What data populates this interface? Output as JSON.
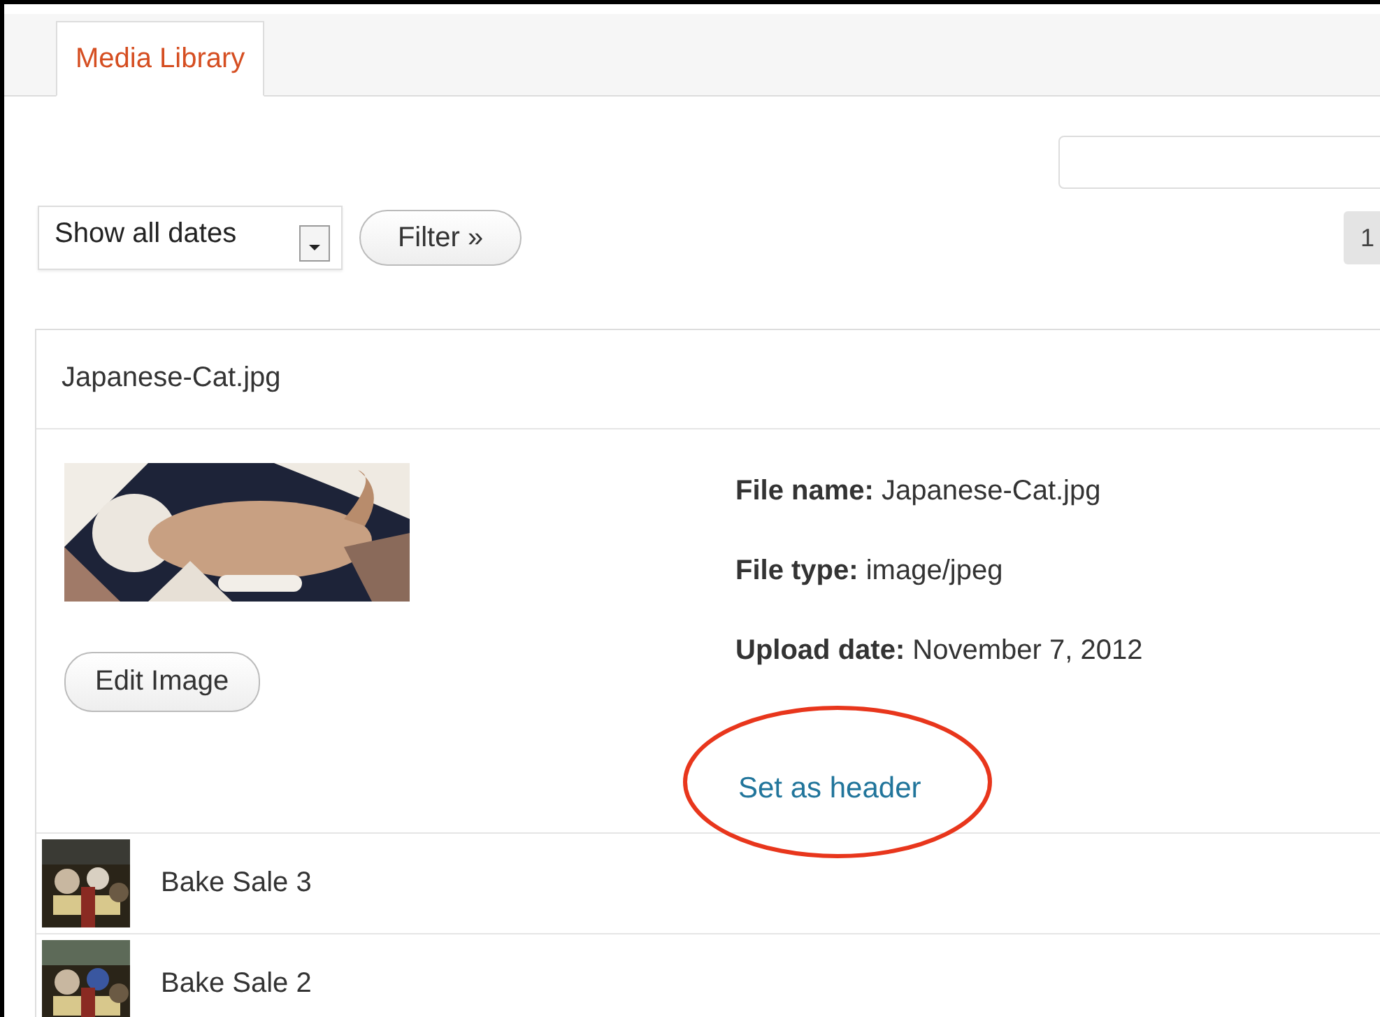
{
  "tabs": [
    {
      "label": "Media Library",
      "selected": true
    }
  ],
  "date_filter": {
    "value": "Show all dates"
  },
  "filter_button": "Filter »",
  "pagination": {
    "page": "1"
  },
  "item": {
    "title": "Japanese-Cat.jpg",
    "edit_button": "Edit Image",
    "details": [
      "**File name:** Japanese-Cat.jpg",
      "**File type:** image/jpeg",
      "**Upload date:** November 7, 2012"
    ],
    "link": "Set as header",
    "annotated": true
  },
  "rows": [
    {
      "title": "Bake Sale 3"
    },
    {
      "title": "Bake Sale 2"
    }
  ]
}
